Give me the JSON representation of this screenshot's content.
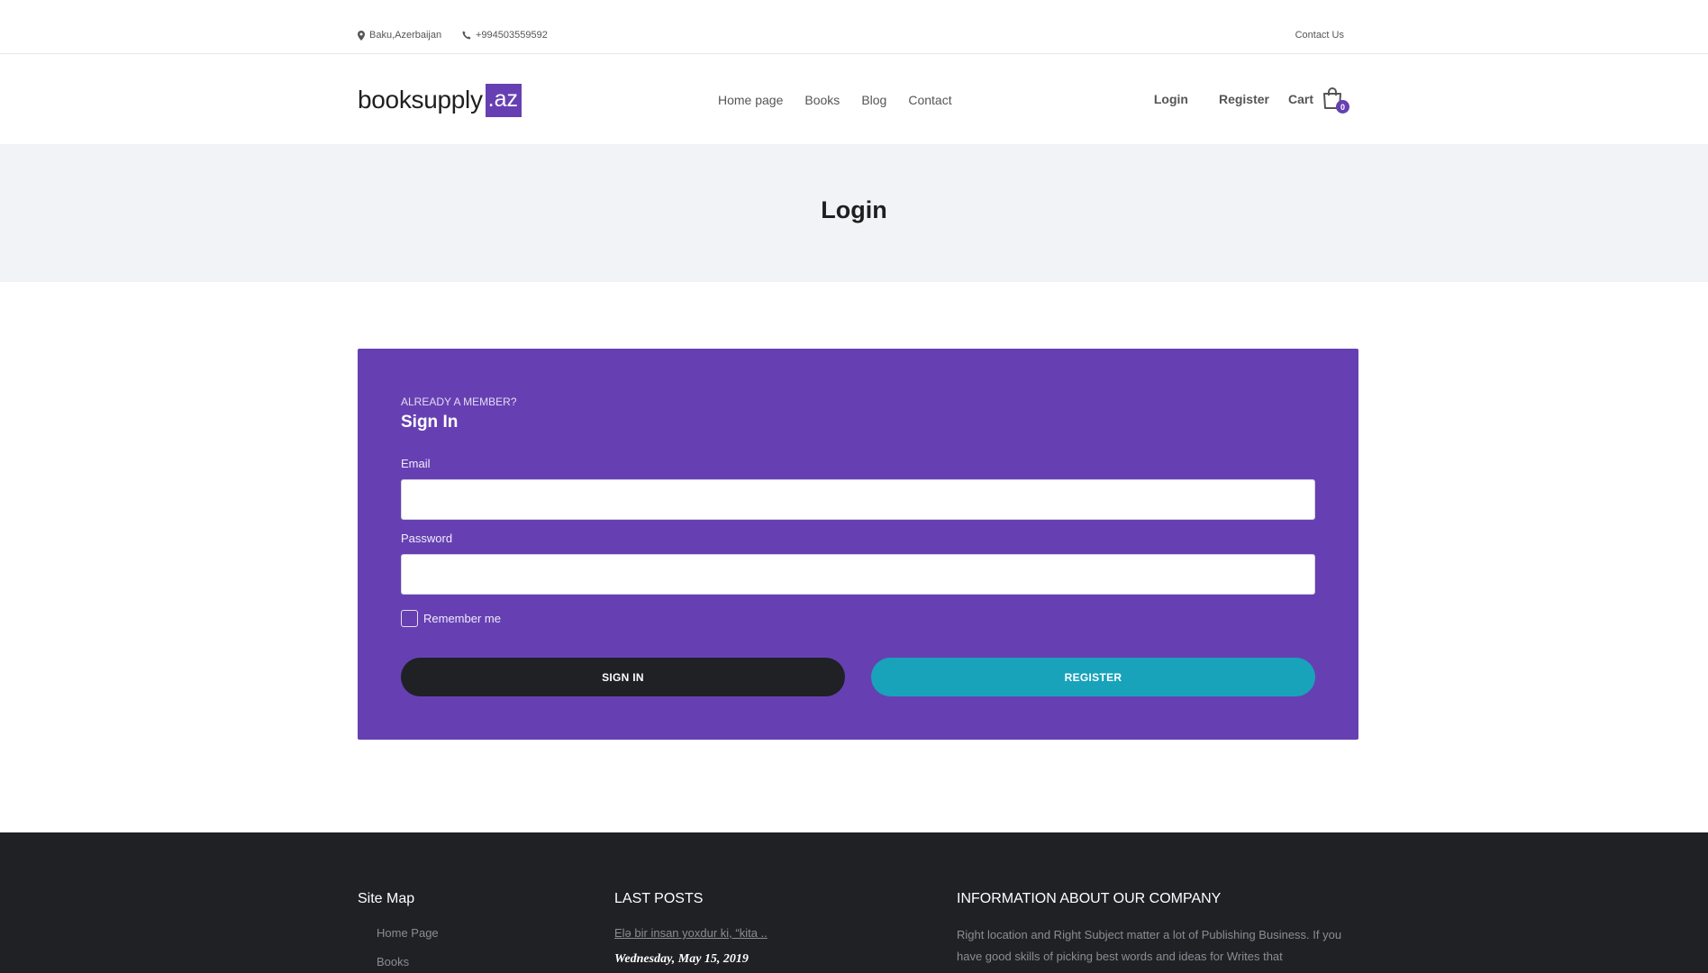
{
  "topbar": {
    "location": "Baku,Azerbaijan",
    "phone": "+994503559592",
    "contact_us": "Contact Us"
  },
  "header": {
    "logo_main": "booksupply",
    "logo_tld": ".az",
    "nav": [
      {
        "label": "Home page"
      },
      {
        "label": "Books"
      },
      {
        "label": "Blog"
      },
      {
        "label": "Contact"
      }
    ],
    "login": "Login",
    "register": "Register",
    "cart": "Cart",
    "cart_count": "0"
  },
  "page_title": "Login",
  "form": {
    "eyebrow": "ALREADY A MEMBER?",
    "heading": "Sign In",
    "email_label": "Email",
    "email_value": "",
    "password_label": "Password",
    "password_value": "",
    "remember_label": "Remember me",
    "remember_checked": false,
    "signin_button": "SIGN IN",
    "register_button": "REGISTER"
  },
  "footer": {
    "site_map_title": "Site Map",
    "site_map_links": [
      {
        "label": "Home Page"
      },
      {
        "label": "Books"
      }
    ],
    "last_posts_title": "LAST POSTS",
    "post_title": "Elə bir insan yoxdur ki, “kita ..",
    "post_date": "Wednesday, May 15, 2019",
    "info_title": "INFORMATION ABOUT OUR COMPANY",
    "info_text": "Right location and Right Subject matter a lot of Publishing Business. If you have good skills of picking best words and ideas for Writes that"
  },
  "colors": {
    "accent": "#6640b2",
    "register_button": "#18a3bb",
    "dark": "#1f2125"
  }
}
